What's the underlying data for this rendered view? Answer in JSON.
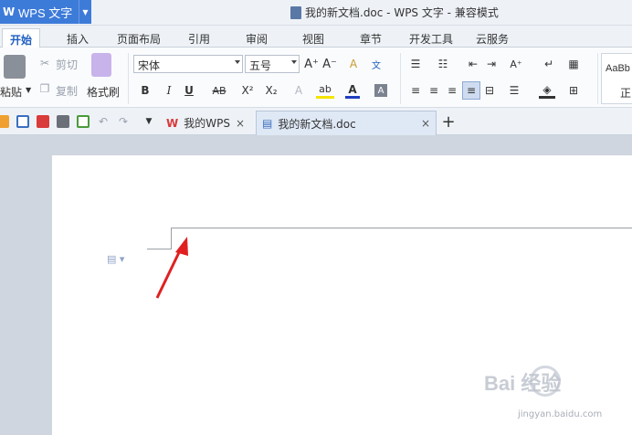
{
  "titlebar": {
    "app_name": "WPS 文字",
    "doc_title": "我的新文档.doc - WPS 文字 - 兼容模式"
  },
  "menu": {
    "tabs": [
      "开始",
      "插入",
      "页面布局",
      "引用",
      "审阅",
      "视图",
      "章节",
      "开发工具",
      "云服务"
    ],
    "active": "开始"
  },
  "ribbon": {
    "paste_label": "粘贴",
    "cut_label": "剪切",
    "copy_label": "复制",
    "format_painter_label": "格式刷",
    "font_name": "宋体",
    "font_size": "五号",
    "bold": "B",
    "italic": "I",
    "underline": "U",
    "strike": "AB",
    "superscript": "X²",
    "subscript": "X₂",
    "style_preview_1": "AaBb",
    "style_preview_2": "正"
  },
  "quickbar": {
    "tabs": [
      {
        "label": "我的WPS"
      },
      {
        "label": "我的新文档.doc"
      }
    ],
    "active_tab": "我的新文档.doc",
    "new_tab_label": "+"
  },
  "watermark": {
    "text": "Bai 经验",
    "sub": "jingyan.baidu.com"
  },
  "colors": {
    "accent": "#3d7bd9",
    "annotation_arrow": "#e02020"
  }
}
